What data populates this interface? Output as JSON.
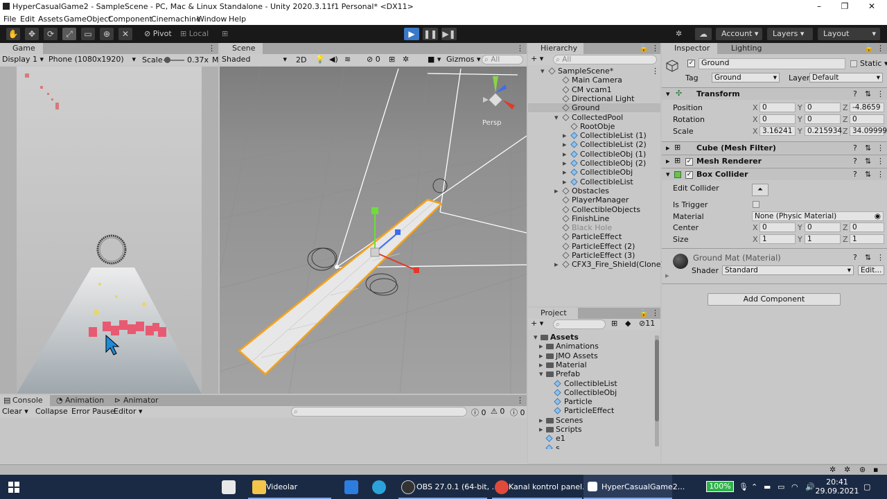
{
  "window": {
    "title": "HyperCasualGame2 - SampleScene - PC, Mac & Linux Standalone - Unity 2020.3.11f1 Personal* <DX11>"
  },
  "menu": [
    "File",
    "Edit",
    "Assets",
    "GameObject",
    "Component",
    "Cinemachine",
    "Window",
    "Help"
  ],
  "toolbar": {
    "pivot": "Pivot",
    "local": "Local",
    "account": "Account",
    "layers": "Layers",
    "layout": "Layout"
  },
  "game": {
    "tab": "Game",
    "display": "Display 1",
    "resolution": "Phone (1080x1920)",
    "scale_label": "Scale",
    "scale_value": "0.37x",
    "m": "M"
  },
  "scene": {
    "tab": "Scene",
    "shading": "Shaded",
    "mode2d": "2D",
    "hidden_count": "0",
    "gizmos": "Gizmos",
    "search_all": "All",
    "persp": "Persp"
  },
  "hierarchy": {
    "tab": "Hierarchy",
    "search_all": "All",
    "items": [
      {
        "label": "SampleScene*",
        "depth": 0,
        "type": "scene"
      },
      {
        "label": "Main Camera",
        "depth": 1,
        "type": "cube"
      },
      {
        "label": "CM vcam1",
        "depth": 1,
        "type": "cube"
      },
      {
        "label": "Directional Light",
        "depth": 1,
        "type": "cube"
      },
      {
        "label": "Ground",
        "depth": 1,
        "type": "cube",
        "selected": true
      },
      {
        "label": "CollectedPool",
        "depth": 1,
        "type": "cube",
        "expanded": true
      },
      {
        "label": "RootObje",
        "depth": 2,
        "type": "cube"
      },
      {
        "label": "CollectibleList (1)",
        "depth": 2,
        "type": "prefab"
      },
      {
        "label": "CollectibleList (2)",
        "depth": 2,
        "type": "prefab"
      },
      {
        "label": "CollectibleObj (1)",
        "depth": 2,
        "type": "prefab"
      },
      {
        "label": "CollectibleObj (2)",
        "depth": 2,
        "type": "prefab"
      },
      {
        "label": "CollectibleObj",
        "depth": 2,
        "type": "prefab"
      },
      {
        "label": "CollectibleList",
        "depth": 2,
        "type": "prefab"
      },
      {
        "label": "Obstacles",
        "depth": 1,
        "type": "cube",
        "collapsed": true
      },
      {
        "label": "PlayerManager",
        "depth": 1,
        "type": "cube"
      },
      {
        "label": "CollectibleObjects",
        "depth": 1,
        "type": "cube"
      },
      {
        "label": "FinishLine",
        "depth": 1,
        "type": "cube"
      },
      {
        "label": "Black Hole",
        "depth": 1,
        "type": "cube",
        "dim": true
      },
      {
        "label": "ParticleEffect",
        "depth": 1,
        "type": "cube"
      },
      {
        "label": "ParticleEffect (2)",
        "depth": 1,
        "type": "cube"
      },
      {
        "label": "ParticleEffect (3)",
        "depth": 1,
        "type": "cube"
      },
      {
        "label": "CFX3_Fire_Shield(Clone)",
        "depth": 1,
        "type": "cube",
        "collapsed": true
      }
    ]
  },
  "project": {
    "tab": "Project",
    "count": "11",
    "items": [
      {
        "label": "Assets",
        "depth": 0,
        "folder": true
      },
      {
        "label": "Animations",
        "depth": 1,
        "folder": true
      },
      {
        "label": "JMO Assets",
        "depth": 1,
        "folder": true
      },
      {
        "label": "Material",
        "depth": 1,
        "folder": true
      },
      {
        "label": "Prefab",
        "depth": 1,
        "folder": true
      },
      {
        "label": "CollectibleList",
        "depth": 2,
        "folder": false
      },
      {
        "label": "CollectibleObj",
        "depth": 2,
        "folder": false
      },
      {
        "label": "Particle",
        "depth": 2,
        "folder": false
      },
      {
        "label": "ParticleEffect",
        "depth": 2,
        "folder": false
      },
      {
        "label": "Scenes",
        "depth": 1,
        "folder": true
      },
      {
        "label": "Scripts",
        "depth": 1,
        "folder": true
      },
      {
        "label": "e1",
        "depth": 1,
        "folder": false
      },
      {
        "label": "s",
        "depth": 1,
        "folder": false
      }
    ]
  },
  "inspector": {
    "tab": "Inspector",
    "tab2": "Lighting",
    "object_name": "Ground",
    "static": "Static",
    "tag_label": "Tag",
    "tag": "Ground",
    "layer_label": "Layer",
    "layer": "Default",
    "transform": {
      "title": "Transform",
      "position_label": "Position",
      "rotation_label": "Rotation",
      "scale_label": "Scale",
      "position": [
        "0",
        "0",
        "-4.8659"
      ],
      "rotation": [
        "0",
        "0",
        "0"
      ],
      "scale": [
        "3.16241",
        "0.215934",
        "34.09999"
      ]
    },
    "mesh_filter": "Cube (Mesh Filter)",
    "mesh_renderer": "Mesh Renderer",
    "box_collider": {
      "title": "Box Collider",
      "edit_collider": "Edit Collider",
      "is_trigger": "Is Trigger",
      "material_label": "Material",
      "material": "None (Physic Material)",
      "center_label": "Center",
      "center": [
        "0",
        "0",
        "0"
      ],
      "size_label": "Size",
      "size": [
        "1",
        "1",
        "1"
      ]
    },
    "material": {
      "title": "Ground Mat (Material)",
      "shader_label": "Shader",
      "shader": "Standard",
      "edit": "Edit..."
    },
    "add_component": "Add Component"
  },
  "console": {
    "tabs": [
      "Console",
      "Animation",
      "Animator"
    ],
    "clear": "Clear",
    "collapse": "Collapse",
    "error_pause": "Error Pause",
    "editor": "Editor",
    "counts": [
      "0",
      "0",
      "0"
    ]
  },
  "taskbar": {
    "items": [
      "Videolar",
      "OBS 27.0.1 (64-bit, ...",
      "Kanal kontrol panel...",
      "HyperCasualGame2..."
    ],
    "battery": "100%",
    "time": "20:41",
    "date": "29.09.2021"
  },
  "colors": {
    "selection": "#b8b8b8",
    "play_blue": "#3a79c9",
    "taskbar": "#1b2a44",
    "accent_orange": "#f5a21b"
  }
}
